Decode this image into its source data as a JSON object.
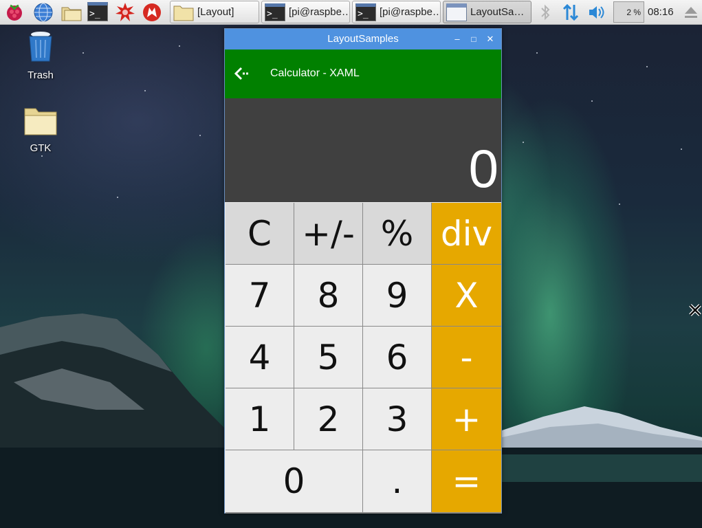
{
  "taskbar": {
    "tasks": [
      {
        "label": "[Layout]",
        "icon": "folder-icon"
      },
      {
        "label": "[pi@raspbe…",
        "icon": "terminal-icon"
      },
      {
        "label": "[pi@raspbe…",
        "icon": "terminal-icon"
      },
      {
        "label": "LayoutSa…",
        "icon": "window-icon"
      }
    ],
    "cpu_usage": "2 %",
    "clock": "08:16"
  },
  "desktop": {
    "icons": [
      {
        "label": "Trash",
        "icon": "trash-icon"
      },
      {
        "label": "GTK",
        "icon": "folder-icon"
      }
    ]
  },
  "window": {
    "title": "LayoutSamples",
    "minimize": "–",
    "maximize": "□",
    "close": "✕"
  },
  "app": {
    "title": "Calculator - XAML",
    "display_value": "0",
    "accent_colors": {
      "appbar": "#018000",
      "operator": "#e6a800",
      "display": "#404040"
    }
  },
  "keys": {
    "clear": "C",
    "sign": "+/-",
    "percent": "%",
    "divide": "div",
    "seven": "7",
    "eight": "8",
    "nine": "9",
    "multiply": "X",
    "four": "4",
    "five": "5",
    "six": "6",
    "subtract": "-",
    "one": "1",
    "two": "2",
    "three": "3",
    "add": "+",
    "zero": "0",
    "decimal": ".",
    "equals": "="
  }
}
